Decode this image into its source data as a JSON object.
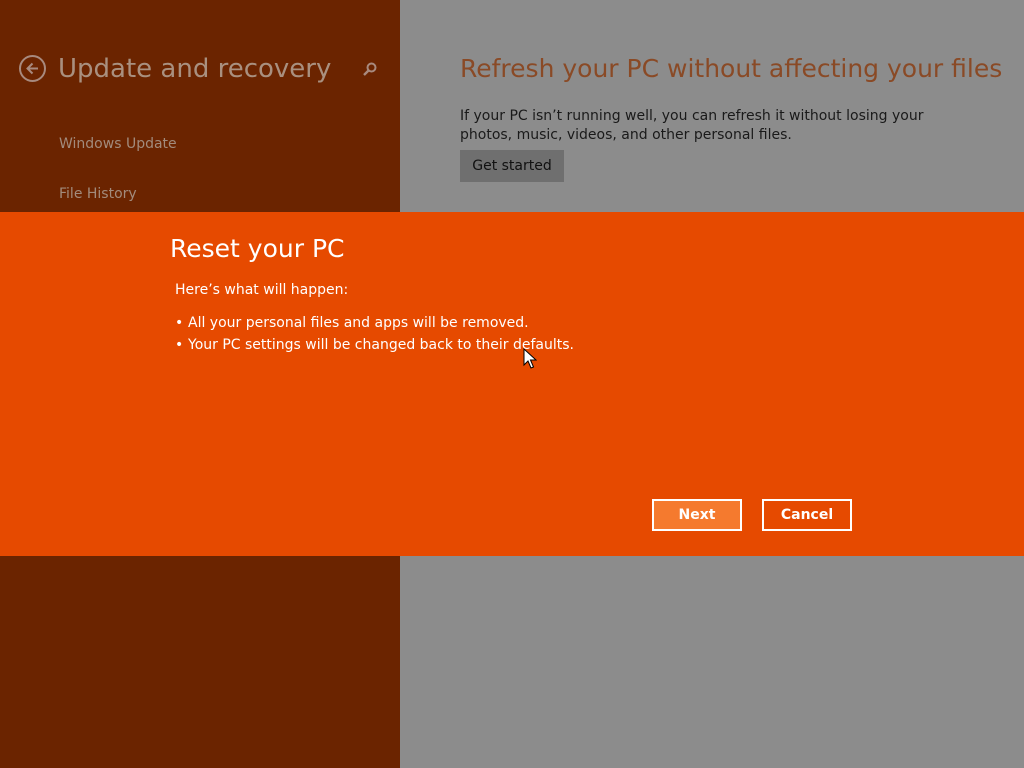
{
  "colors": {
    "left_pane_bg": "#6b2400",
    "right_pane_bg": "#8c8c8c",
    "dialog_bg": "#e64a00",
    "next_button_bg": "#f57a2e"
  },
  "settings": {
    "back_icon": "back-arrow-icon",
    "title": "Update and recovery",
    "search_icon": "search-icon",
    "nav_items": [
      {
        "label": "Windows Update"
      },
      {
        "label": "File History"
      }
    ]
  },
  "refresh": {
    "title": "Refresh your PC without affecting your files",
    "description": "If your PC isn’t running well, you can refresh it without losing your photos, music, videos, and other personal files.",
    "button_label": "Get started"
  },
  "dialog": {
    "title": "Reset your PC",
    "intro": "Here’s what will happen:",
    "bullet_char": "•",
    "items": [
      "All your personal files and apps will be removed.",
      "Your PC settings will be changed back to their defaults."
    ],
    "next_label": "Next",
    "cancel_label": "Cancel"
  }
}
